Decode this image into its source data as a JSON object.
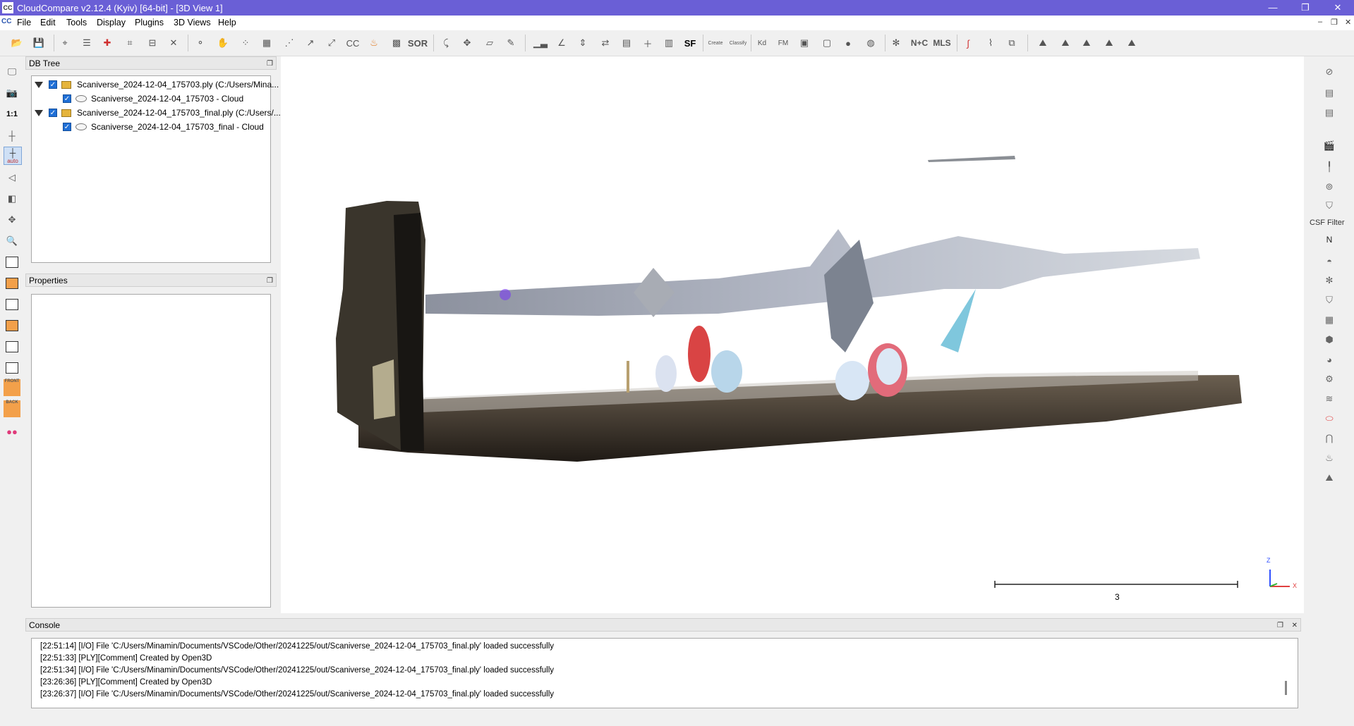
{
  "window": {
    "title": "CloudCompare v2.12.4 (Kyiv) [64-bit] - [3D View 1]",
    "app_icon_text": "CC",
    "controls": {
      "minimize": "—",
      "restore": "❐",
      "close": "✕"
    }
  },
  "menu": {
    "items": [
      "File",
      "Edit",
      "Tools",
      "Display",
      "Plugins",
      "3D Views",
      "Help"
    ],
    "mdi_controls": {
      "minimize": "–",
      "restore": "❐",
      "close": "✕"
    }
  },
  "toolbar": {
    "sor_label": "SOR",
    "sf_label": "SF",
    "kd_label": "Kd",
    "fm_label": "FM",
    "nc_label": "N+C",
    "mls_label": "MLS",
    "canupo_create_label": "Create",
    "canupo_classify_label": "Classify"
  },
  "left_toolbar": {
    "one_to_one_label": "1:1",
    "auto_label": "auto",
    "front_label": "FRONT",
    "back_label": "BACK"
  },
  "db_tree": {
    "title": "DB Tree",
    "items": [
      {
        "label": "Scaniverse_2024-12-04_175703.ply (C:/Users/Mina...",
        "child": "Scaniverse_2024-12-04_175703 - Cloud"
      },
      {
        "label": "Scaniverse_2024-12-04_175703_final.ply (C:/Users/...",
        "child": "Scaniverse_2024-12-04_175703_final - Cloud"
      }
    ]
  },
  "properties": {
    "title": "Properties"
  },
  "view": {
    "scale_label": "3",
    "axis_z": "Z",
    "axis_x": "X"
  },
  "right_toolbar": {
    "csf_label": "CSF Filter",
    "n_label": "N"
  },
  "console": {
    "title": "Console",
    "lines": [
      "[22:51:14] [I/O] File 'C:/Users/Minamin/Documents/VSCode/Other/20241225/out/Scaniverse_2024-12-04_175703_final.ply' loaded successfully",
      "[22:51:33] [PLY][Comment] Created by Open3D",
      "[22:51:34] [I/O] File 'C:/Users/Minamin/Documents/VSCode/Other/20241225/out/Scaniverse_2024-12-04_175703_final.ply' loaded successfully",
      "[23:26:36] [PLY][Comment] Created by Open3D",
      "[23:26:37] [I/O] File 'C:/Users/Minamin/Documents/VSCode/Other/20241225/out/Scaniverse_2024-12-04_175703_final.ply' loaded successfully"
    ]
  }
}
